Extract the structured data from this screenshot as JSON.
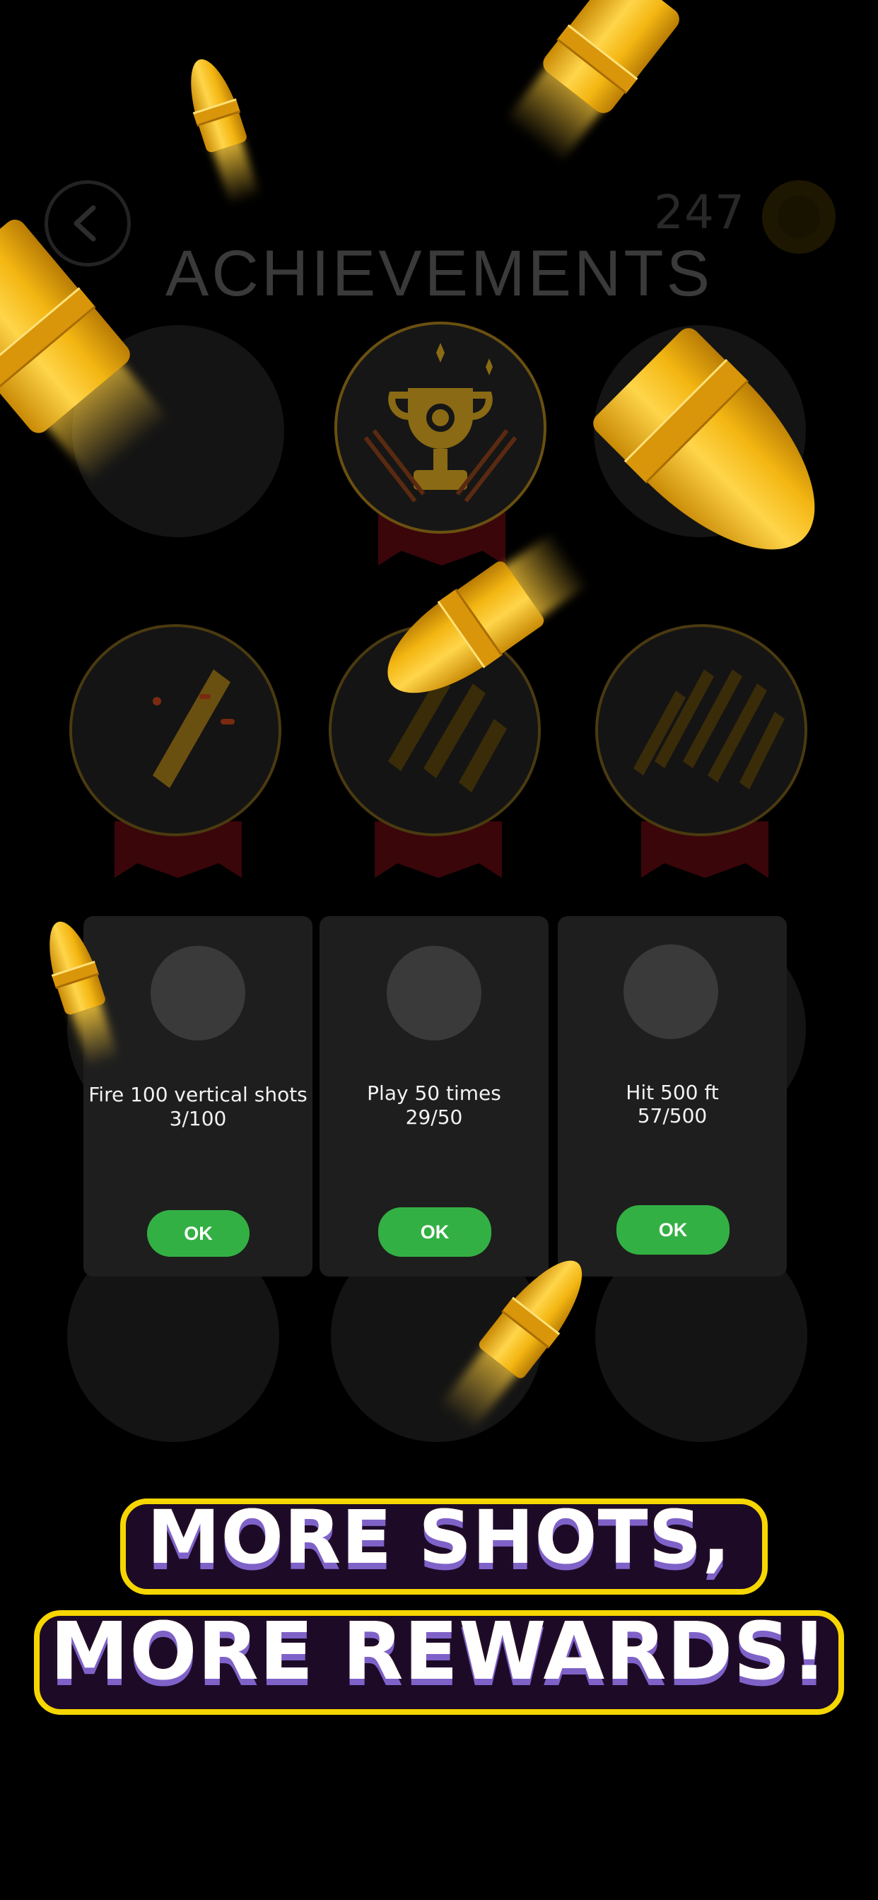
{
  "header": {
    "title": "ACHIEVEMENTS",
    "coin_count": "247"
  },
  "cards": [
    {
      "text": "Fire 100 vertical shots",
      "progress": "3/100",
      "ok_label": "OK"
    },
    {
      "text": "Play 50 times",
      "progress": "29/50",
      "ok_label": "OK"
    },
    {
      "text": "Hit 500 ft",
      "progress": "57/500",
      "ok_label": "OK"
    }
  ],
  "slogan": {
    "line1": "MORE SHOTS,",
    "line2": "MORE REWARDS!"
  },
  "icons": {
    "back": "back-arrow-icon",
    "coin": "coin-icon",
    "trophy": "trophy-icon"
  },
  "colors": {
    "background": "#000000",
    "ok_button": "#33b043",
    "gold": "#f3b612",
    "slogan_border": "#f6d600",
    "slogan_shadow": "#7f62c8"
  }
}
